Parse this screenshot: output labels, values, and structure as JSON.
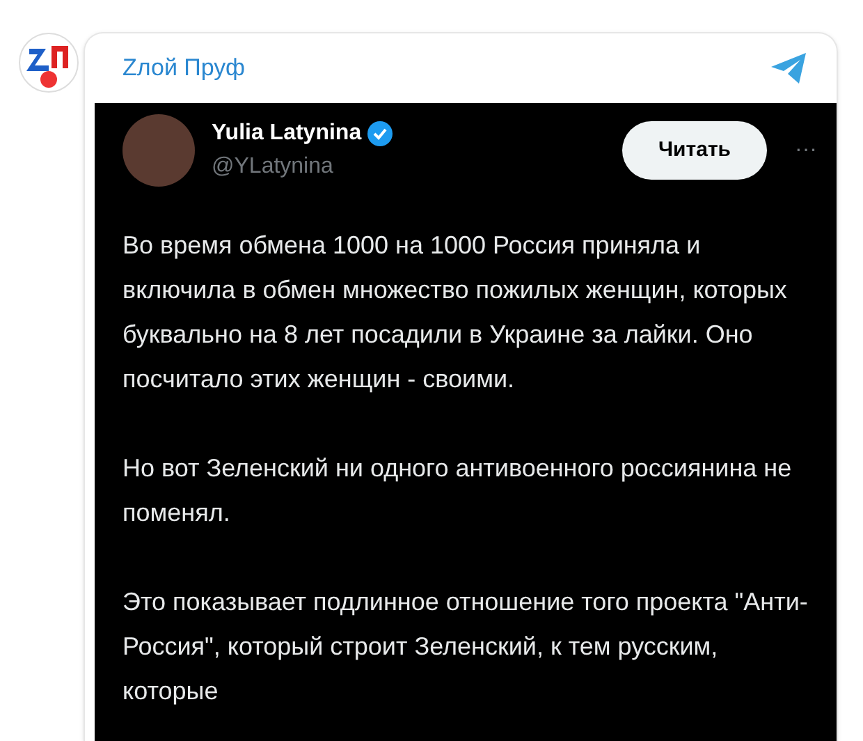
{
  "channel": {
    "name": "Zлой Пруф"
  },
  "tweet": {
    "author": "Yulia Latynina",
    "verified": true,
    "handle": "@YLatynina",
    "follow_button": "Читать",
    "more": "···",
    "paragraphs": [
      "Во время обмена 1000 на 1000 Россия приняла и включила в обмен множество пожилых женщин, которых буквально на 8 лет посадили в Украине за лайки. Оно посчитало этих женщин - своими.",
      "Но вот Зеленский ни одного антивоенного россиянина не поменял.",
      "Это показывает подлинное отношение того проекта \"Анти-Россия\", который строит Зеленский, к тем русским, которые"
    ]
  }
}
